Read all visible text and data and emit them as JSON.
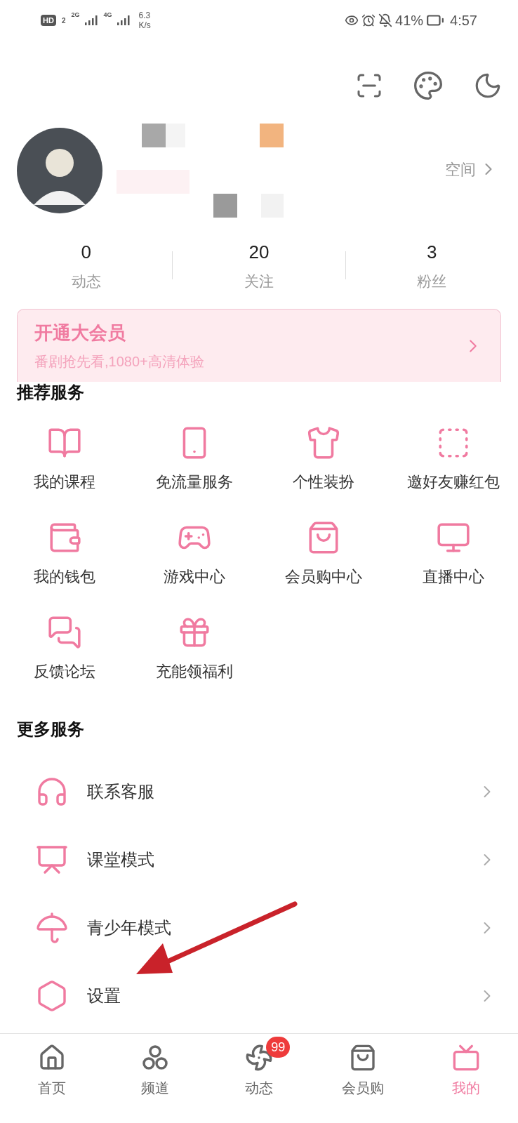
{
  "status_bar": {
    "hd": "HD",
    "sim": "2",
    "net_1": "2G",
    "net_2": "4G",
    "speed": "6.3",
    "speed_unit": "K/s",
    "battery": "41%",
    "time": "4:57"
  },
  "profile": {
    "space_link": "空间"
  },
  "stats": [
    {
      "value": "0",
      "label": "动态"
    },
    {
      "value": "20",
      "label": "关注"
    },
    {
      "value": "3",
      "label": "粉丝"
    }
  ],
  "vip_banner": {
    "title": "开通大会员",
    "subtitle": "番剧抢先看,1080+高清体验"
  },
  "recommended": {
    "heading": "推荐服务",
    "items": [
      {
        "label": "我的课程"
      },
      {
        "label": "免流量服务"
      },
      {
        "label": "个性装扮"
      },
      {
        "label": "邀好友赚红包"
      },
      {
        "label": "我的钱包"
      },
      {
        "label": "游戏中心"
      },
      {
        "label": "会员购中心"
      },
      {
        "label": "直播中心"
      },
      {
        "label": "反馈论坛"
      },
      {
        "label": "充能领福利"
      }
    ]
  },
  "more": {
    "heading": "更多服务",
    "items": [
      {
        "label": "联系客服"
      },
      {
        "label": "课堂模式"
      },
      {
        "label": "青少年模式"
      },
      {
        "label": "设置"
      }
    ]
  },
  "bottom_nav": [
    {
      "label": "首页",
      "selected": false
    },
    {
      "label": "频道",
      "selected": false
    },
    {
      "label": "动态",
      "selected": false,
      "badge": "99"
    },
    {
      "label": "会员购",
      "selected": false
    },
    {
      "label": "我的",
      "selected": true
    }
  ]
}
